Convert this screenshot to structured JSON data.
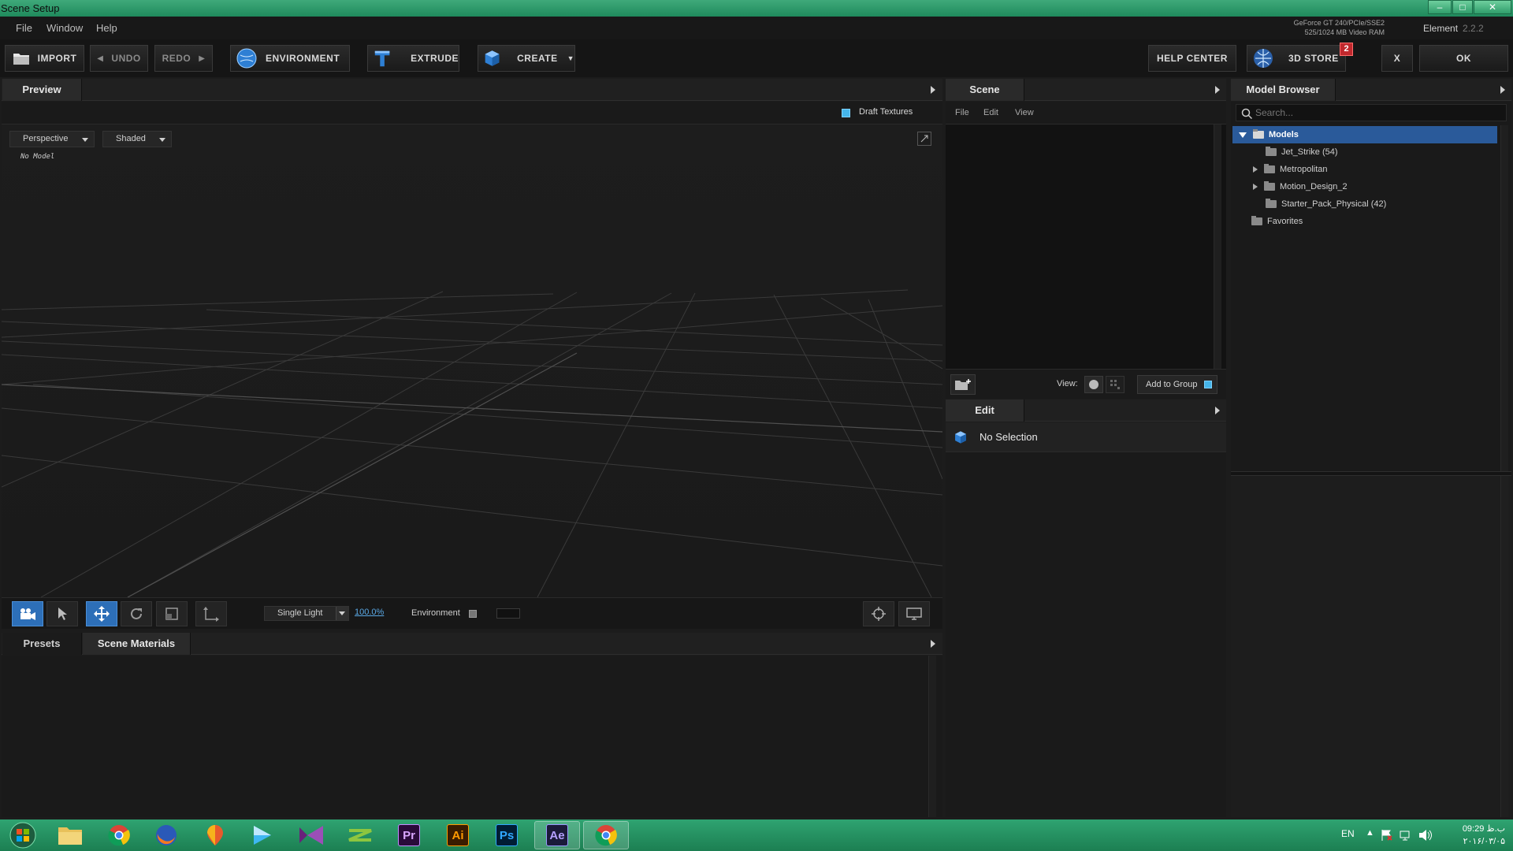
{
  "window": {
    "title": "Scene Setup",
    "controls": [
      "–",
      "□",
      "✕"
    ]
  },
  "menu": {
    "items": [
      "File",
      "Window",
      "Help"
    ]
  },
  "gpu": {
    "line1": "GeForce GT 240/PCIe/SSE2",
    "line2": "525/1024 MB Video RAM"
  },
  "product": {
    "name": "Element",
    "version": "2.2.2"
  },
  "toolbar": {
    "import": "IMPORT",
    "undo": "UNDO",
    "redo": "REDO",
    "environment": "ENVIRONMENT",
    "extrude": "EXTRUDE",
    "create": "CREATE",
    "help_center": "HELP CENTER",
    "store": "3D STORE",
    "store_badge": "2",
    "close": "X",
    "ok": "OK"
  },
  "preview": {
    "tab": "Preview",
    "draft_textures": "Draft Textures",
    "perspective": "Perspective",
    "shaded": "Shaded",
    "no_model": "No Model",
    "light_mode": "Single Light",
    "zoom": "100.0%",
    "environment_label": "Environment"
  },
  "bottom_panel": {
    "tabs": [
      "Presets",
      "Scene Materials"
    ]
  },
  "scene": {
    "tab": "Scene",
    "menu": [
      "File",
      "Edit",
      "View"
    ],
    "view_label": "View:",
    "add_to_group": "Add to Group"
  },
  "edit": {
    "tab": "Edit",
    "status": "No Selection"
  },
  "model_browser": {
    "tab": "Model Browser",
    "search_placeholder": "Search...",
    "tree": [
      {
        "label": "Models",
        "expanded": true,
        "selected": true
      },
      {
        "label": "Jet_Strike (54)"
      },
      {
        "label": "Metropolitan",
        "expandable": true
      },
      {
        "label": "Motion_Design_2",
        "expandable": true
      },
      {
        "label": "Starter_Pack_Physical (42)"
      },
      {
        "label": "Favorites"
      }
    ]
  },
  "taskbar": {
    "apps": [
      "Start",
      "Explorer",
      "Chrome",
      "Firefox",
      "Maps",
      "Player",
      "Visual Studio",
      "Camtasia",
      "Pr",
      "Ai",
      "Ps",
      "Ae",
      "Chrome"
    ],
    "lang": "EN",
    "time": "09:29 ب.ظ",
    "date": "۲۰۱۶/۰۳/۰۵"
  },
  "colors": {
    "accent_blue": "#2d6fb8",
    "selection": "#2a5a9a",
    "title_green": "#2fa371",
    "badge_red": "#c0282d"
  }
}
